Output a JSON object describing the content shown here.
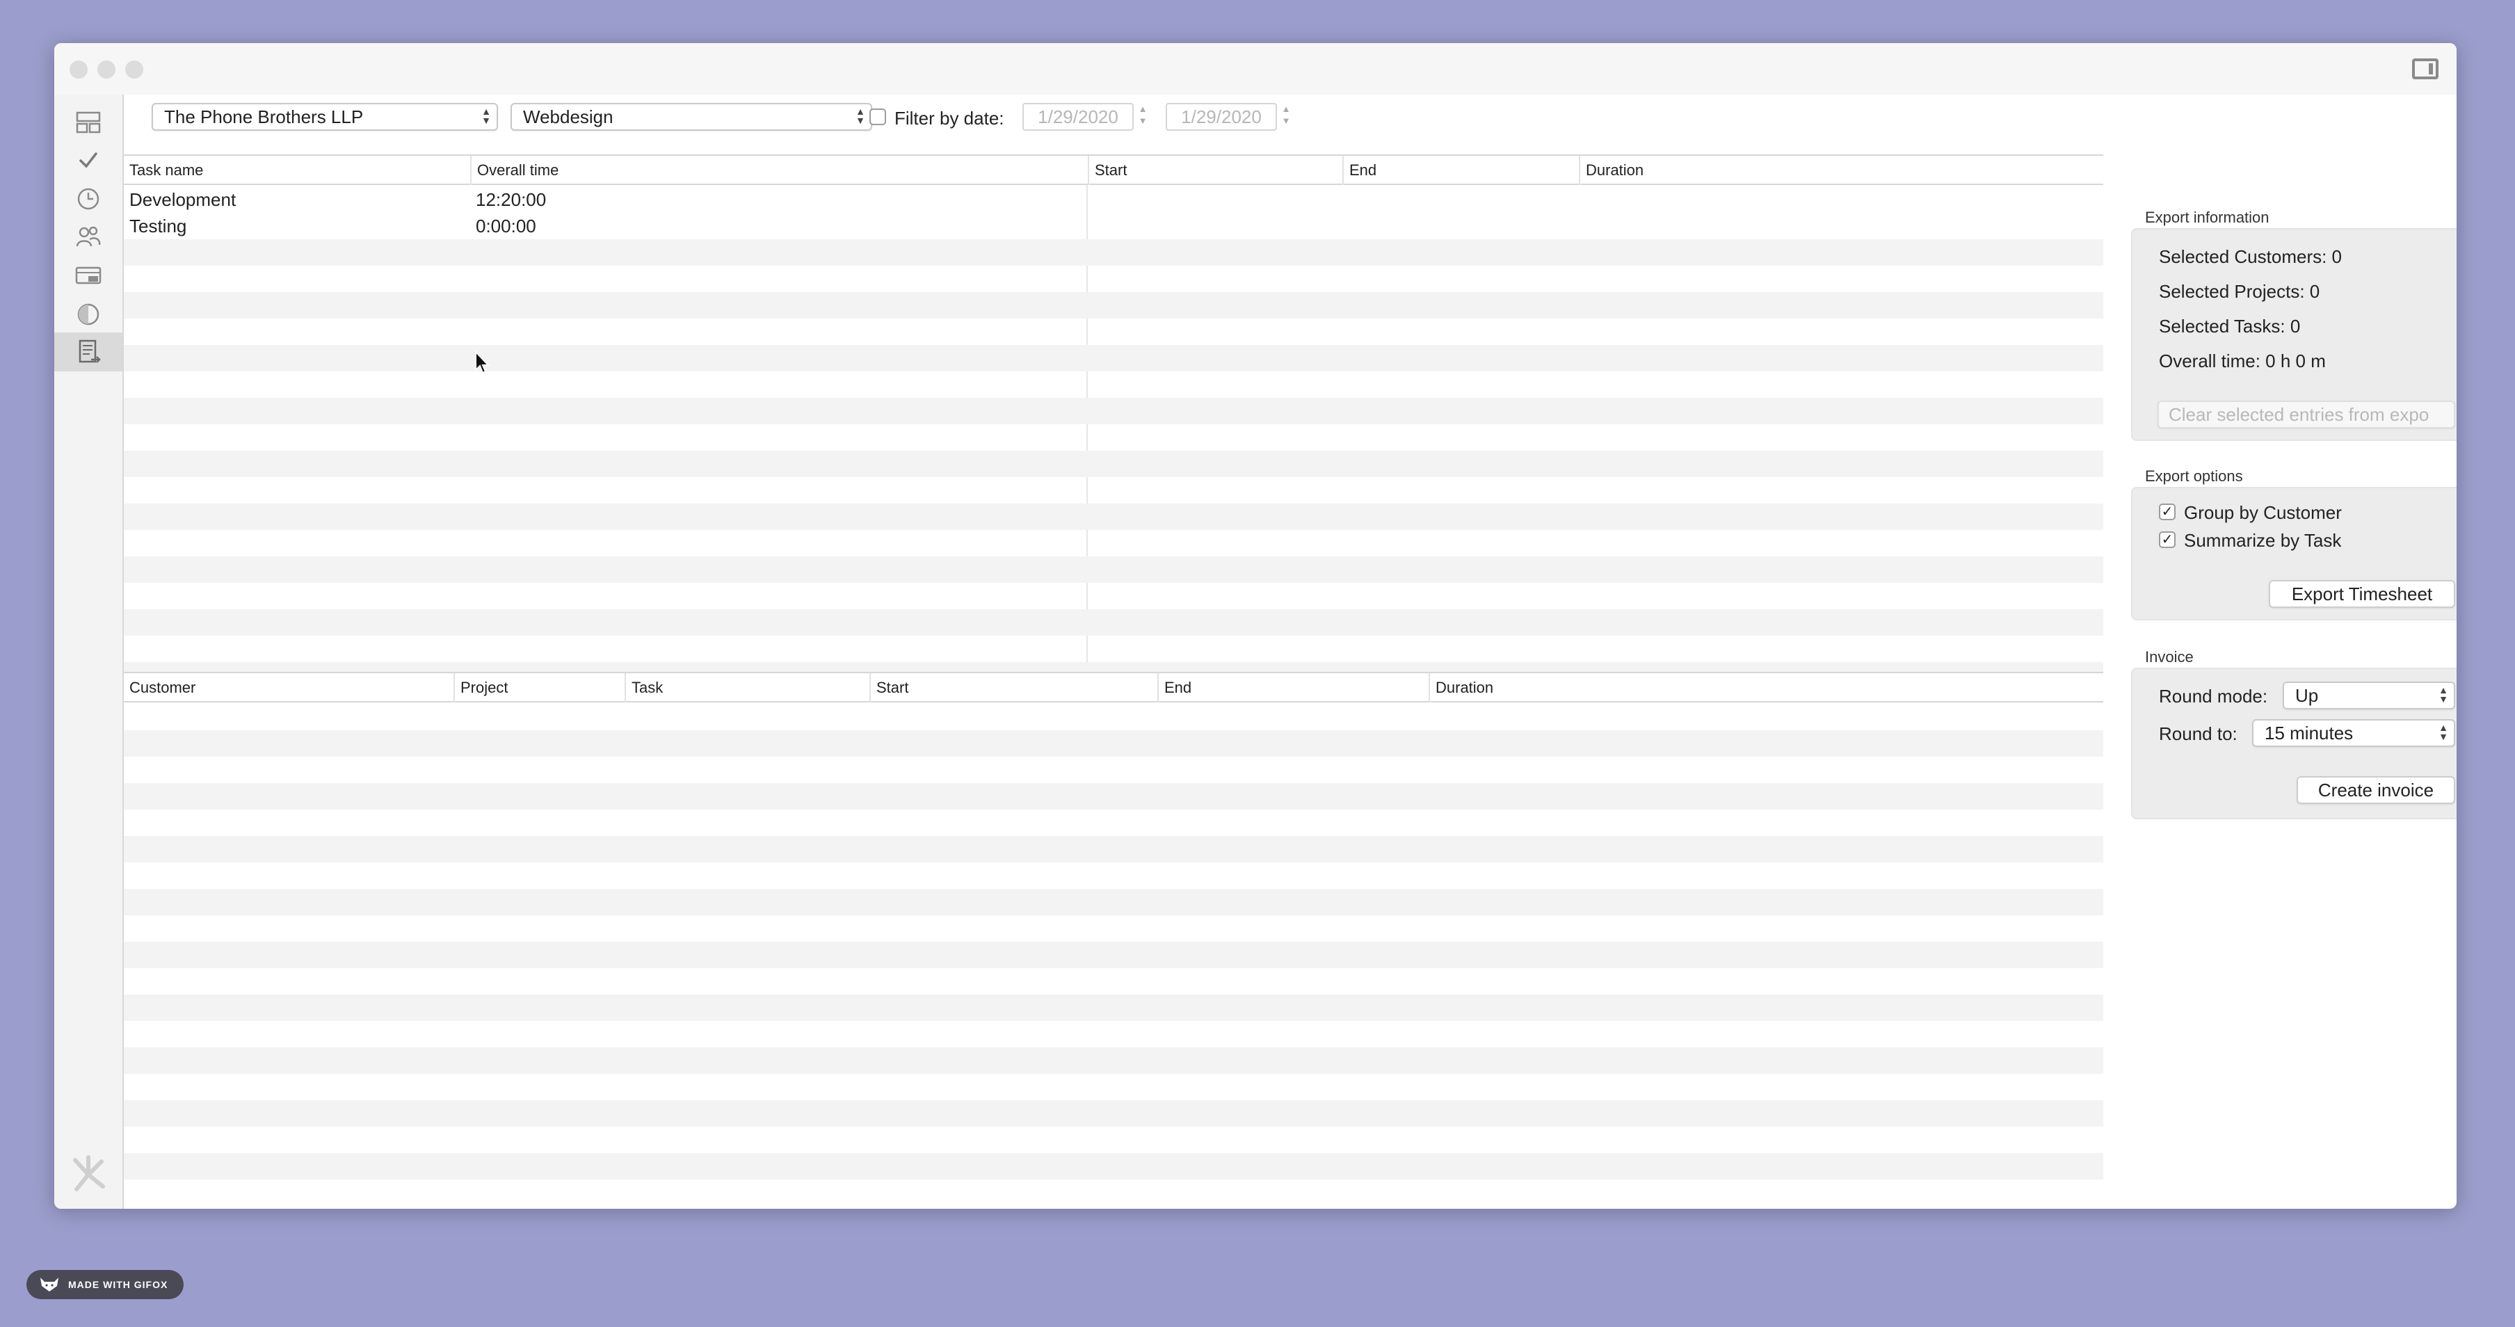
{
  "toolbar": {
    "customer_select": "The Phone Brothers LLP",
    "project_select": "Webdesign",
    "filter_label": "Filter by date:",
    "date_from": "1/29/2020",
    "date_to": "1/29/2020"
  },
  "task_table": {
    "headers": [
      "Task name",
      "Overall time",
      "Start",
      "End",
      "Duration"
    ],
    "rows": [
      {
        "task": "Development",
        "time": "12:20:00"
      },
      {
        "task": "Testing",
        "time": "0:00:00"
      }
    ]
  },
  "entries_table": {
    "headers": [
      "Customer",
      "Project",
      "Task",
      "Start",
      "End",
      "Duration"
    ]
  },
  "export_info": {
    "title": "Export information",
    "customers": "Selected Customers: 0",
    "projects": "Selected Projects: 0",
    "tasks": "Selected Tasks: 0",
    "overall": "Overall time: 0 h 0 m",
    "clear_button": "Clear selected entries from expo"
  },
  "export_options": {
    "title": "Export options",
    "group_by_customer": "Group by Customer",
    "summarize_by_task": "Summarize by Task",
    "export_button": "Export Timesheet"
  },
  "invoice": {
    "title": "Invoice",
    "round_mode_label": "Round mode:",
    "round_mode_value": "Up",
    "round_to_label": "Round to:",
    "round_to_value": "15 minutes",
    "create_button": "Create invoice"
  },
  "watermark": "MADE WITH GIFOX"
}
